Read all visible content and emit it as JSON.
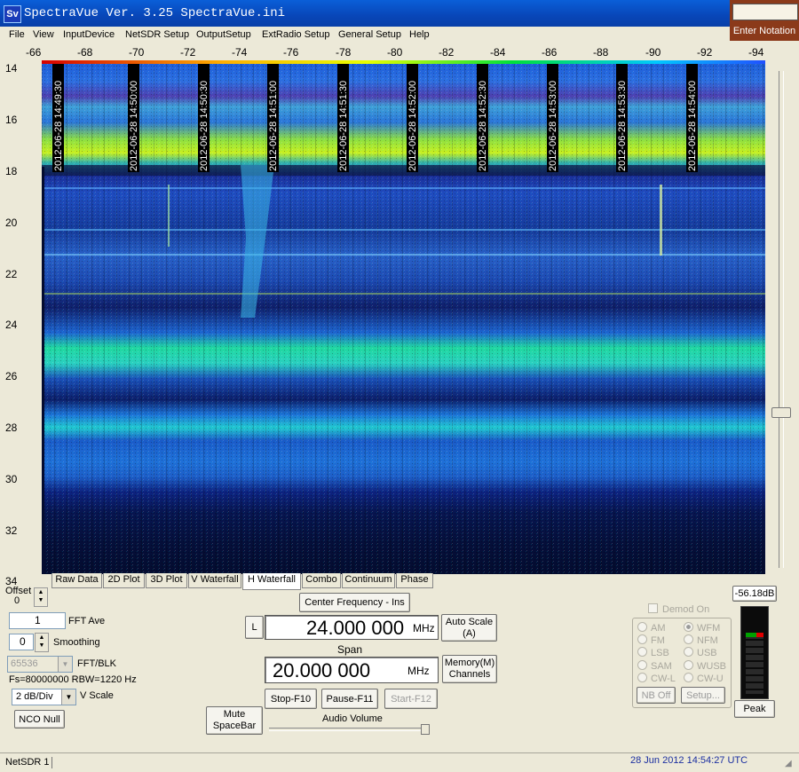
{
  "window": {
    "title": "SpectraVue Ver. 3.25  SpectraVue.ini",
    "icon_text": "Sv"
  },
  "notation": {
    "button_label": "Enter Notation"
  },
  "menu": [
    "File",
    "View",
    "InputDevice",
    "NetSDR Setup",
    "OutputSetup",
    "ExtRadio Setup",
    "General Setup",
    "Help"
  ],
  "x_ticks": [
    "-66",
    "-68",
    "-70",
    "-72",
    "-74",
    "-76",
    "-78",
    "-80",
    "-82",
    "-84",
    "-86",
    "-88",
    "-90",
    "-92",
    "-94"
  ],
  "y_ticks": [
    "14",
    "16",
    "18",
    "20",
    "22",
    "24",
    "26",
    "28",
    "30",
    "32",
    "34"
  ],
  "timestamps": [
    "2012-06-28 14:49:30",
    "2012-06-28 14:50:00",
    "2012-06-28 14:50:30",
    "2012-06-28 14:51:00",
    "2012-06-28 14:51:30",
    "2012-06-28 14:52:00",
    "2012-06-28 14:52:30",
    "2012-06-28 14:53:00",
    "2012-06-28 14:53:30",
    "2012-06-28 14:54:00"
  ],
  "tabs": [
    "Raw Data",
    "2D Plot",
    "3D Plot",
    "V Waterfall",
    "H Waterfall",
    "Combo",
    "Continuum",
    "Phase"
  ],
  "active_tab": "H Waterfall",
  "controls": {
    "offset_label": "Offset",
    "offset_value": "0",
    "fft_ave_value": "1",
    "fft_ave_label": "FFT Ave",
    "smoothing_value": "0",
    "smoothing_label": "Smoothing",
    "fft_blk_value": "65536",
    "fft_blk_label": "FFT/BLK",
    "fs_info": "Fs=80000000 RBW=1220 Hz",
    "vscale_value": "2 dB/Div",
    "vscale_label": "V Scale",
    "nco_null": "NCO Null",
    "mute_line1": "Mute",
    "mute_line2": "SpaceBar"
  },
  "center": {
    "center_freq_button": "Center Frequency - Ins",
    "l_button": "L",
    "freq_value": "24.000 000",
    "freq_unit": "MHz",
    "auto_scale_line1": "Auto Scale",
    "auto_scale_line2": "(A)",
    "span_label": "Span",
    "span_value": "20.000 000",
    "span_unit": "MHz",
    "memory_line1": "Memory(M)",
    "memory_line2": "Channels",
    "stop": "Stop-F10",
    "pause": "Pause-F11",
    "start": "Start-F12",
    "audio_volume": "Audio Volume"
  },
  "demod": {
    "title": "Demod On",
    "modes": [
      "AM",
      "WFM",
      "FM",
      "NFM",
      "LSB",
      "USB",
      "SAM",
      "WUSB",
      "CW-L",
      "CW-U"
    ],
    "selected": "WFM",
    "nb_off": "NB Off",
    "setup": "Setup..."
  },
  "meter": {
    "reading": "-56.18dB",
    "peak_label": "Peak"
  },
  "status": {
    "left": "NetSDR 1",
    "right": "28 Jun 2012  14:54:27 UTC"
  }
}
